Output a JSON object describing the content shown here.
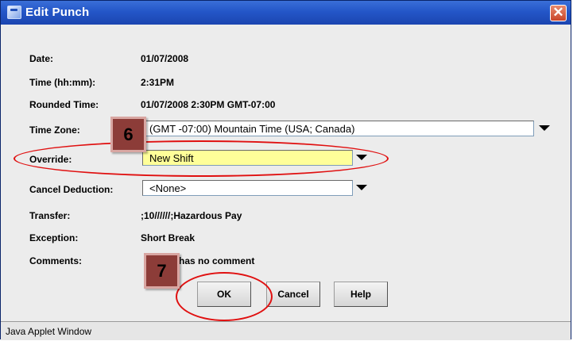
{
  "window": {
    "title": "Edit Punch",
    "close_glyph": "✕",
    "title_icon": "java-cup-icon",
    "close_icon": "close-icon"
  },
  "fields": {
    "date": {
      "label": "Date:",
      "value": "01/07/2008"
    },
    "time": {
      "label": "Time (hh:mm):",
      "value": "2:31PM"
    },
    "rounded_time": {
      "label": "Rounded Time:",
      "value": "01/07/2008 2:30PM GMT-07:00"
    },
    "time_zone": {
      "label": "Time Zone:",
      "selected": "(GMT -07:00) Mountain Time (USA; Canada)"
    },
    "override": {
      "label": "Override:",
      "selected": "New Shift"
    },
    "cancel_deduction": {
      "label": "Cancel Deduction:",
      "selected": "<None>"
    },
    "transfer": {
      "label": "Transfer:",
      "value": ";10//////;Hazardous Pay"
    },
    "exception": {
      "label": "Exception:",
      "value": "Short Break"
    },
    "comments": {
      "label": "Comments:",
      "value": "has no comment"
    }
  },
  "buttons": {
    "ok": "OK",
    "cancel": "Cancel",
    "help": "Help"
  },
  "markers": {
    "step6": "6",
    "step7": "7"
  },
  "statusbar": {
    "text": "Java Applet Window"
  },
  "colors": {
    "titlebar": "#2456c8",
    "override_highlight": "#ffff99",
    "annotation_red": "#e01010",
    "marker_fill": "#8c3c38"
  }
}
